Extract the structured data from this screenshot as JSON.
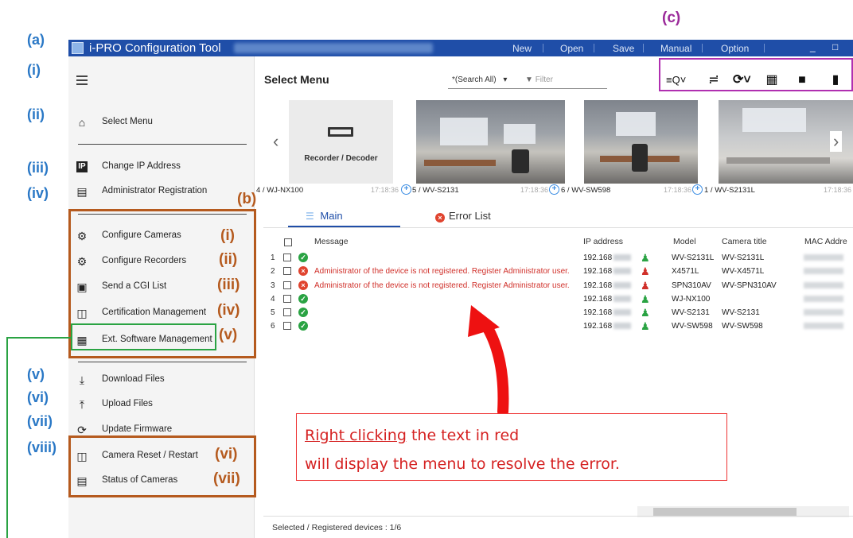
{
  "annotations": {
    "a": "(a)",
    "a_items": [
      "(i)",
      "(ii)",
      "(iii)",
      "(iv)",
      "(v)",
      "(vi)",
      "(vii)",
      "(viii)"
    ],
    "b": "(b)",
    "b_items": [
      "(i)",
      "(ii)",
      "(iii)",
      "(iv)",
      "(v)",
      "(vi)",
      "(vii)"
    ],
    "c": "(c)"
  },
  "titlebar": {
    "title": "i-PRO Configuration Tool",
    "menu": [
      "New",
      "Open",
      "Save",
      "Manual",
      "Option"
    ],
    "minimize": "_",
    "maximize": "□"
  },
  "sidebar": {
    "menu_icon": "hamburger-icon",
    "items": [
      {
        "label": "Select Menu",
        "icon": "home-icon"
      },
      {
        "label": "Change IP Address",
        "icon": "ip-icon"
      },
      {
        "label": "Administrator Registration",
        "icon": "admin-card-icon"
      },
      {
        "label": "Configure Cameras",
        "icon": "camera-gear-icon"
      },
      {
        "label": "Configure Recorders",
        "icon": "recorder-gear-icon"
      },
      {
        "label": "Send a CGI List",
        "icon": "cgi-icon"
      },
      {
        "label": "Certification Management",
        "icon": "certificate-icon"
      },
      {
        "label": "Ext. Software Management",
        "icon": "software-icon"
      },
      {
        "label": "Download Files",
        "icon": "download-icon"
      },
      {
        "label": "Upload Files",
        "icon": "upload-icon"
      },
      {
        "label": "Update Firmware",
        "icon": "firmware-icon"
      },
      {
        "label": "Camera Reset / Restart",
        "icon": "reset-icon"
      },
      {
        "label": "Status of Cameras",
        "icon": "status-icon"
      }
    ]
  },
  "main": {
    "title": "Select Menu",
    "search_scope": "*(Search All)",
    "search_arrow": "▾",
    "filter_placeholder": "Filter",
    "toolbar_icons": [
      "search-list-icon",
      "add-device-icon",
      "refresh-icon",
      "qr-code-icon",
      "delete-icon",
      "comment-icon"
    ],
    "devices": [
      {
        "caption": "4 / WJ-NX100",
        "time": "17:18:36",
        "card_label": "Recorder / Decoder"
      },
      {
        "caption": "5 / WV-S2131",
        "time": "17:18:36"
      },
      {
        "caption": "6 / WV-SW598",
        "time": "17:18:36"
      },
      {
        "caption": "1 / WV-S2131L",
        "time": "17:18:36"
      }
    ],
    "tabs": [
      {
        "label": "Main"
      },
      {
        "label": "Error List"
      }
    ],
    "table": {
      "headers": [
        "Message",
        "IP address",
        "Model",
        "Camera title",
        "MAC Addre"
      ],
      "rows": [
        {
          "n": "1",
          "status": "ok",
          "message": "",
          "ip": "192.168",
          "model": "WV-S2131L",
          "title": "WV-S2131L"
        },
        {
          "n": "2",
          "status": "error",
          "message": "Administrator of the device is not registered. Register Administrator user.",
          "ip": "192.168",
          "model": "X4571L",
          "title": "WV-X4571L"
        },
        {
          "n": "3",
          "status": "error",
          "message": "Administrator of the device is not registered. Register Administrator user.",
          "ip": "192.168",
          "model": "SPN310AV",
          "title": "WV-SPN310AV"
        },
        {
          "n": "4",
          "status": "ok",
          "message": "",
          "ip": "192.168",
          "model": "WJ-NX100",
          "title": ""
        },
        {
          "n": "5",
          "status": "ok",
          "message": "",
          "ip": "192.168",
          "model": "WV-S2131",
          "title": "WV-S2131"
        },
        {
          "n": "6",
          "status": "ok",
          "message": "",
          "ip": "192.168",
          "model": "WV-SW598",
          "title": "WV-SW598"
        }
      ]
    },
    "callout": {
      "underlined": "Right clicking",
      "line1_rest": " the text in red",
      "line2": "will display the menu to resolve the error."
    },
    "status_bar": "Selected / Registered devices : 1/6"
  },
  "colors": {
    "titlebar": "#1f4ea8",
    "annotation_blue": "#2a78c6",
    "annotation_brown": "#b55a1e",
    "annotation_purple": "#9b2a9a",
    "error_red": "#d0302a",
    "ok_green": "#2aa343"
  }
}
